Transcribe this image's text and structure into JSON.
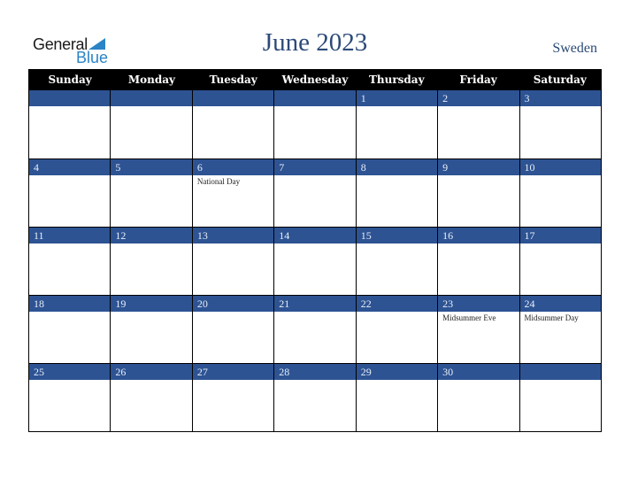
{
  "logo": {
    "line1": "General",
    "line2": "Blue"
  },
  "title": "June 2023",
  "country": "Sweden",
  "colors": {
    "header_bg": "#000000",
    "date_bar": "#2d5393",
    "title": "#2c4a78",
    "logo_blue": "#2a84c6"
  },
  "weekdays": [
    "Sunday",
    "Monday",
    "Tuesday",
    "Wednesday",
    "Thursday",
    "Friday",
    "Saturday"
  ],
  "weeks": [
    [
      {
        "day": "",
        "event": ""
      },
      {
        "day": "",
        "event": ""
      },
      {
        "day": "",
        "event": ""
      },
      {
        "day": "",
        "event": ""
      },
      {
        "day": "1",
        "event": ""
      },
      {
        "day": "2",
        "event": ""
      },
      {
        "day": "3",
        "event": ""
      }
    ],
    [
      {
        "day": "4",
        "event": ""
      },
      {
        "day": "5",
        "event": ""
      },
      {
        "day": "6",
        "event": "National Day"
      },
      {
        "day": "7",
        "event": ""
      },
      {
        "day": "8",
        "event": ""
      },
      {
        "day": "9",
        "event": ""
      },
      {
        "day": "10",
        "event": ""
      }
    ],
    [
      {
        "day": "11",
        "event": ""
      },
      {
        "day": "12",
        "event": ""
      },
      {
        "day": "13",
        "event": ""
      },
      {
        "day": "14",
        "event": ""
      },
      {
        "day": "15",
        "event": ""
      },
      {
        "day": "16",
        "event": ""
      },
      {
        "day": "17",
        "event": ""
      }
    ],
    [
      {
        "day": "18",
        "event": ""
      },
      {
        "day": "19",
        "event": ""
      },
      {
        "day": "20",
        "event": ""
      },
      {
        "day": "21",
        "event": ""
      },
      {
        "day": "22",
        "event": ""
      },
      {
        "day": "23",
        "event": "Midsummer Eve"
      },
      {
        "day": "24",
        "event": "Midsummer Day"
      }
    ],
    [
      {
        "day": "25",
        "event": ""
      },
      {
        "day": "26",
        "event": ""
      },
      {
        "day": "27",
        "event": ""
      },
      {
        "day": "28",
        "event": ""
      },
      {
        "day": "29",
        "event": ""
      },
      {
        "day": "30",
        "event": ""
      },
      {
        "day": "",
        "event": ""
      }
    ]
  ]
}
